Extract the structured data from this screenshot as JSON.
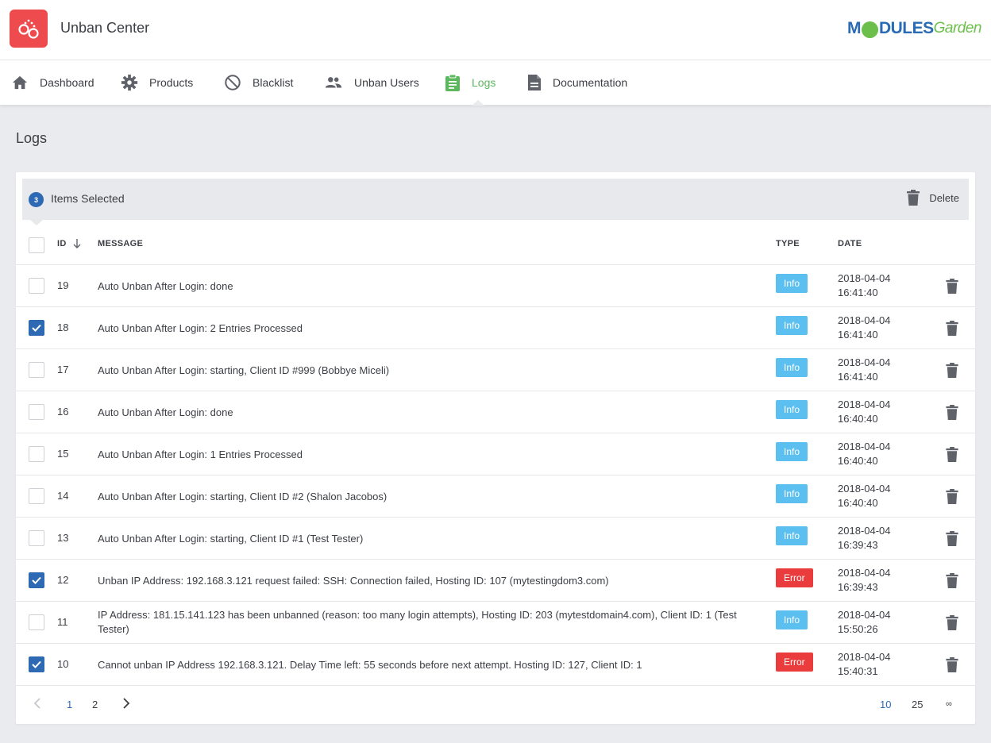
{
  "app": {
    "title": "Unban Center"
  },
  "brand": {
    "part1": "M",
    "part2": "DULES",
    "part3": "Garden"
  },
  "nav": {
    "items": [
      {
        "label": "Dashboard"
      },
      {
        "label": "Products"
      },
      {
        "label": "Blacklist"
      },
      {
        "label": "Unban Users"
      },
      {
        "label": "Logs"
      },
      {
        "label": "Documentation"
      }
    ],
    "active_color": "#5cb85c"
  },
  "page": {
    "title": "Logs"
  },
  "selection": {
    "count": "3",
    "text": "Items Selected",
    "delete_label": "Delete"
  },
  "table": {
    "headers": {
      "id": "ID",
      "message": "MESSAGE",
      "type": "TYPE",
      "date": "DATE"
    },
    "rows": [
      {
        "id": "19",
        "message": "Auto Unban After Login: done",
        "type": "Info",
        "date": "2018-04-04",
        "time": "16:41:40",
        "checked": false
      },
      {
        "id": "18",
        "message": "Auto Unban After Login: 2 Entries Processed",
        "type": "Info",
        "date": "2018-04-04",
        "time": "16:41:40",
        "checked": true
      },
      {
        "id": "17",
        "message": "Auto Unban After Login: starting, Client ID #999 (Bobbye Miceli)",
        "type": "Info",
        "date": "2018-04-04",
        "time": "16:41:40",
        "checked": false
      },
      {
        "id": "16",
        "message": "Auto Unban After Login: done",
        "type": "Info",
        "date": "2018-04-04",
        "time": "16:40:40",
        "checked": false
      },
      {
        "id": "15",
        "message": "Auto Unban After Login: 1 Entries Processed",
        "type": "Info",
        "date": "2018-04-04",
        "time": "16:40:40",
        "checked": false
      },
      {
        "id": "14",
        "message": "Auto Unban After Login: starting, Client ID #2 (Shalon Jacobos)",
        "type": "Info",
        "date": "2018-04-04",
        "time": "16:40:40",
        "checked": false
      },
      {
        "id": "13",
        "message": "Auto Unban After Login: starting, Client ID #1 (Test Tester)",
        "type": "Info",
        "date": "2018-04-04",
        "time": "16:39:43",
        "checked": false
      },
      {
        "id": "12",
        "message": "Unban IP Address: 192.168.3.121 request failed: SSH: Connection failed, Hosting ID: 107 (mytestingdom3.com)",
        "type": "Error",
        "date": "2018-04-04",
        "time": "16:39:43",
        "checked": true
      },
      {
        "id": "11",
        "message": "IP Address: 181.15.141.123 has been unbanned (reason: too many login attempts), Hosting ID: 203 (mytestdomain4.com), Client ID: 1 (Test Tester)",
        "type": "Info",
        "date": "2018-04-04",
        "time": "15:50:26",
        "checked": false
      },
      {
        "id": "10",
        "message": "Cannot unban IP Address 192.168.3.121. Delay Time left: 55 seconds before next attempt. Hosting ID: 127, Client ID: 1",
        "type": "Error",
        "date": "2018-04-04",
        "time": "15:40:31",
        "checked": true
      }
    ]
  },
  "pagination": {
    "prev_icon": "chevron-left-icon",
    "pages": [
      "1",
      "2"
    ],
    "current_page": "1",
    "next_icon": "chevron-right-icon",
    "per_page_options": [
      "10",
      "25",
      "∞"
    ],
    "per_page_selected": "10"
  },
  "colors": {
    "primary": "#2e6ab3",
    "info": "#5bbff0",
    "error": "#ea3c3d",
    "logo_bg": "#ee4b4e"
  }
}
